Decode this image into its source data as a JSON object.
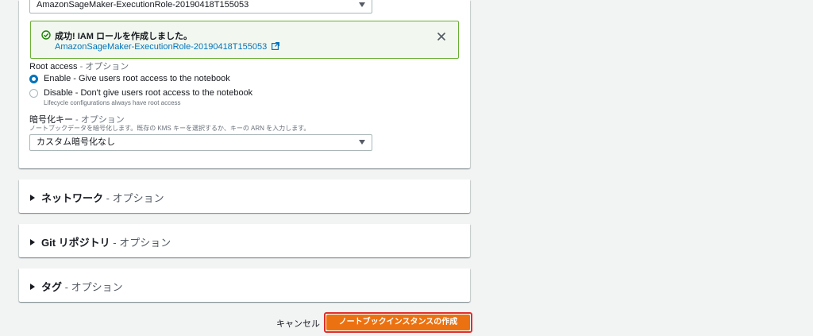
{
  "iam_role_select": {
    "value": "AmazonSageMaker-ExecutionRole-20190418T155053"
  },
  "success_flash": {
    "title": "成功! IAM ロールを作成しました。",
    "link_text": "AmazonSageMaker-ExecutionRole-20190418T155053"
  },
  "root_access": {
    "label": "Root access",
    "optional": " - オプション",
    "options": [
      {
        "label": "Enable - Give users root access to the notebook",
        "selected": true
      },
      {
        "label": "Disable - Don't give users root access to the notebook",
        "selected": false
      }
    ],
    "hint": "Lifecycle configurations always have root access"
  },
  "encryption": {
    "label": "暗号化キー",
    "optional": " - オプション",
    "description": "ノートブックデータを暗号化します。既存の KMS キーを選択するか、キーの ARN を入力します。",
    "select_value": "カスタム暗号化なし"
  },
  "sections": [
    {
      "title": "ネットワーク",
      "optional": " - オプション"
    },
    {
      "title": "Git リポジトリ",
      "optional": " - オプション"
    },
    {
      "title": "タグ",
      "optional": " - オプション"
    }
  ],
  "footer": {
    "cancel_label": "キャンセル",
    "create_label": "ノートブックインスタンスの作成"
  },
  "colors": {
    "primary": "#ec7211",
    "success_border": "#6aaf35",
    "link": "#0073bb",
    "highlight": "#e02d2d"
  }
}
